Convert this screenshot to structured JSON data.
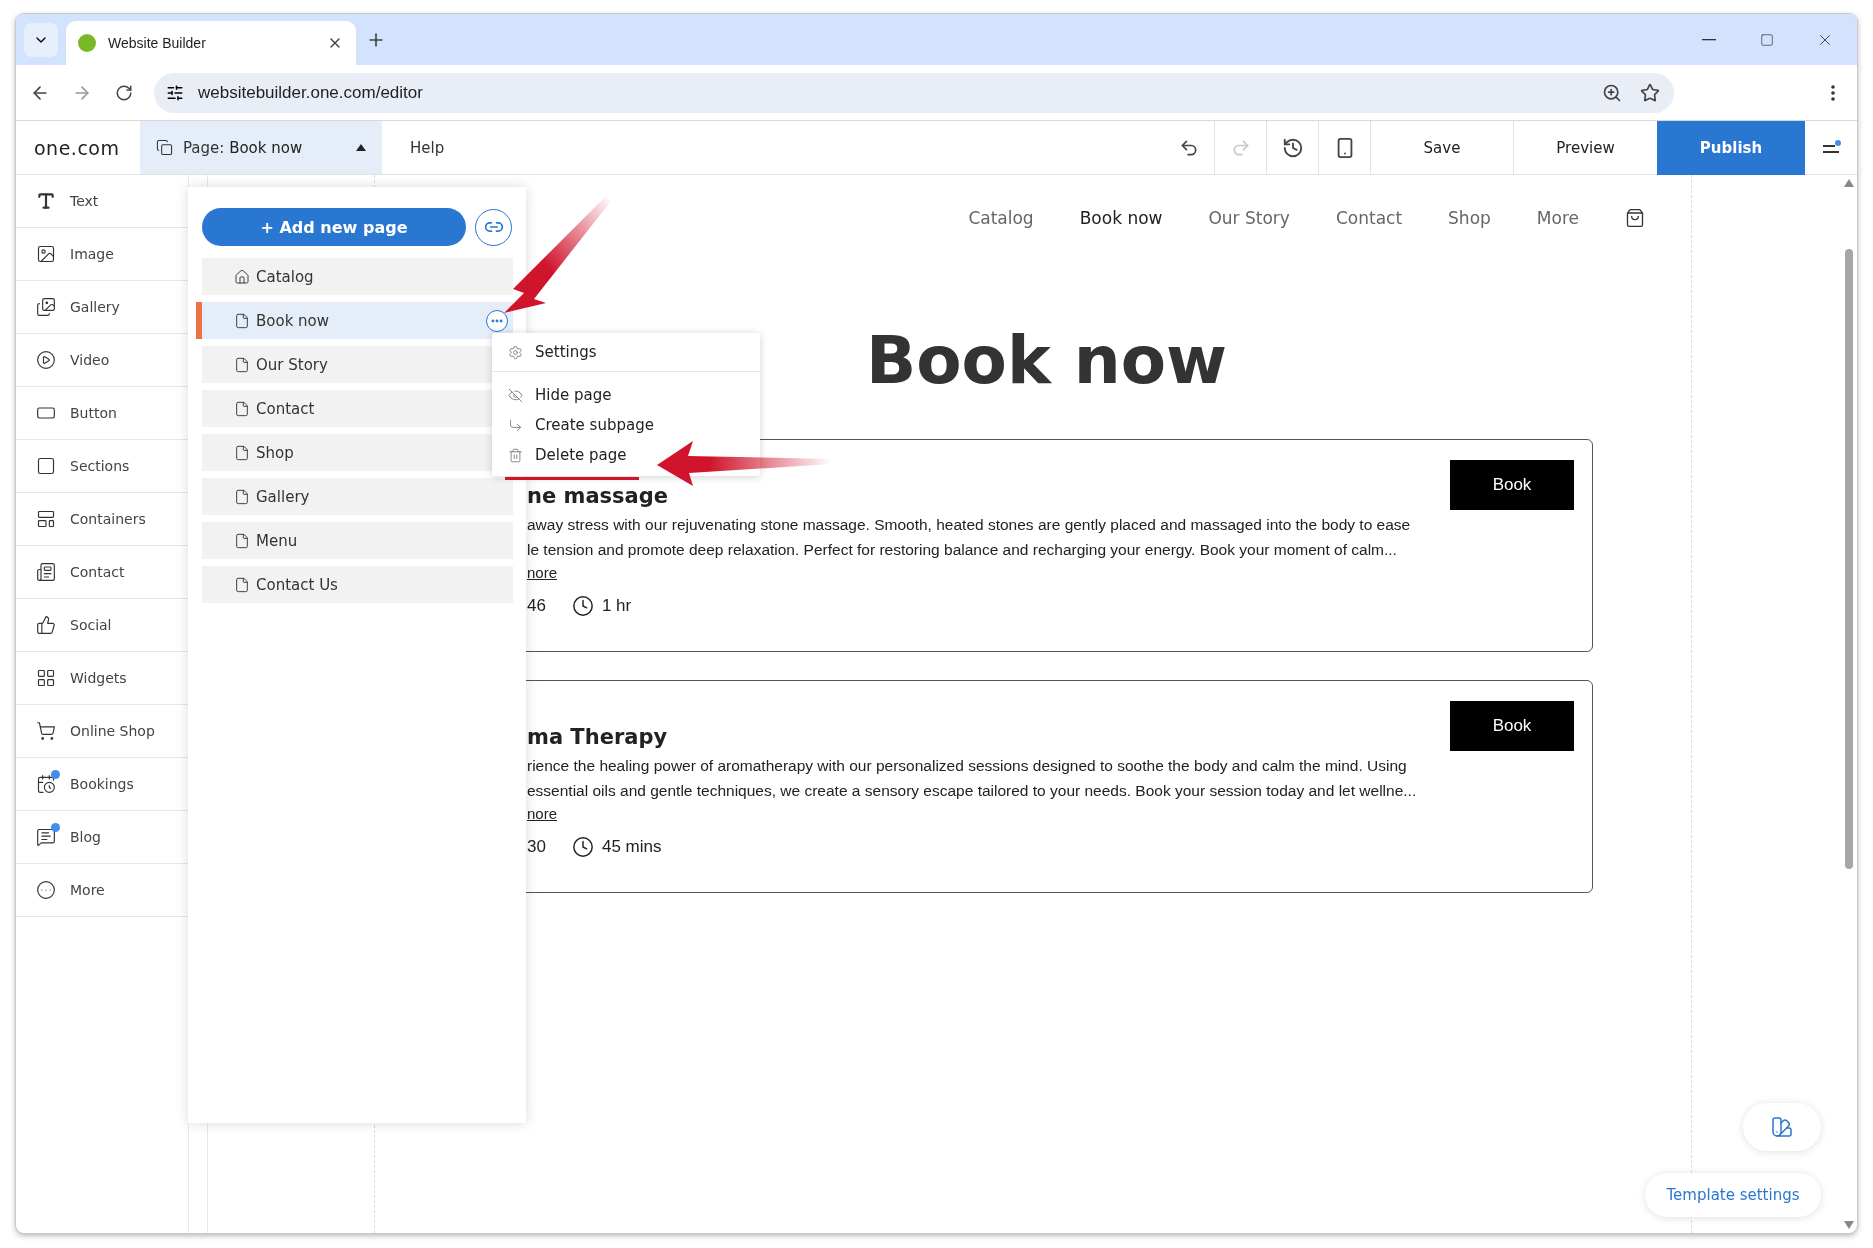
{
  "browser": {
    "tab_title": "Website Builder",
    "url": "websitebuilder.one.com/editor"
  },
  "editor": {
    "logo": "one.com",
    "page_selector": {
      "label": "Page:",
      "value": "Book now"
    },
    "help": "Help",
    "save": "Save",
    "preview": "Preview",
    "publish": "Publish"
  },
  "sidebar": {
    "items": [
      {
        "label": "Text",
        "badge": false
      },
      {
        "label": "Image",
        "badge": false
      },
      {
        "label": "Gallery",
        "badge": false
      },
      {
        "label": "Video",
        "badge": false
      },
      {
        "label": "Button",
        "badge": false
      },
      {
        "label": "Sections",
        "badge": false
      },
      {
        "label": "Containers",
        "badge": false
      },
      {
        "label": "Contact",
        "badge": false
      },
      {
        "label": "Social",
        "badge": false
      },
      {
        "label": "Widgets",
        "badge": false
      },
      {
        "label": "Online Shop",
        "badge": false
      },
      {
        "label": "Bookings",
        "badge": true
      },
      {
        "label": "Blog",
        "badge": true
      },
      {
        "label": "More",
        "badge": false
      }
    ]
  },
  "pages_panel": {
    "add_button": "+ Add new page",
    "pages": [
      {
        "label": "Catalog",
        "kind": "home",
        "selected": false
      },
      {
        "label": "Book now",
        "kind": "page",
        "selected": true
      },
      {
        "label": "Our Story",
        "kind": "page",
        "selected": false
      },
      {
        "label": "Contact",
        "kind": "page",
        "selected": false
      },
      {
        "label": "Shop",
        "kind": "page",
        "selected": false
      },
      {
        "label": "Gallery",
        "kind": "page",
        "selected": false
      },
      {
        "label": "Menu",
        "kind": "page",
        "selected": false
      },
      {
        "label": "Contact Us",
        "kind": "page",
        "selected": false
      }
    ]
  },
  "context_menu": {
    "items": [
      {
        "label": "Settings",
        "divider_after": true
      },
      {
        "label": "Hide page",
        "divider_after": false
      },
      {
        "label": "Create subpage",
        "divider_after": false
      },
      {
        "label": "Delete page",
        "divider_after": false
      }
    ]
  },
  "site": {
    "nav": [
      {
        "label": "Catalog",
        "selected": false
      },
      {
        "label": "Book now",
        "selected": true
      },
      {
        "label": "Our Story",
        "selected": false
      },
      {
        "label": "Contact",
        "selected": false
      },
      {
        "label": "Shop",
        "selected": false
      },
      {
        "label": "More",
        "selected": false
      }
    ],
    "heading": "Book now",
    "cards": [
      {
        "title": "ne massage",
        "description_lines": [
          "away stress with our rejuvenating stone massage. Smooth, heated stones are gently placed and massaged into the body to ease",
          "le tension and promote deep relaxation. Perfect for restoring balance and recharging your energy. Book your moment of calm..."
        ],
        "more": "nore",
        "price": "46",
        "duration": "1 hr",
        "button": "Book"
      },
      {
        "title": "ma Therapy",
        "description_lines": [
          "rience the healing power of aromatherapy with our personalized sessions designed to soothe the body and calm the mind. Using",
          "essential oils and gentle techniques, we create a sensory escape tailored to your needs. Book your session today and let wellne..."
        ],
        "more": "nore",
        "price": "30",
        "duration": "45 mins",
        "button": "Book"
      }
    ]
  },
  "template_settings": "Template settings"
}
